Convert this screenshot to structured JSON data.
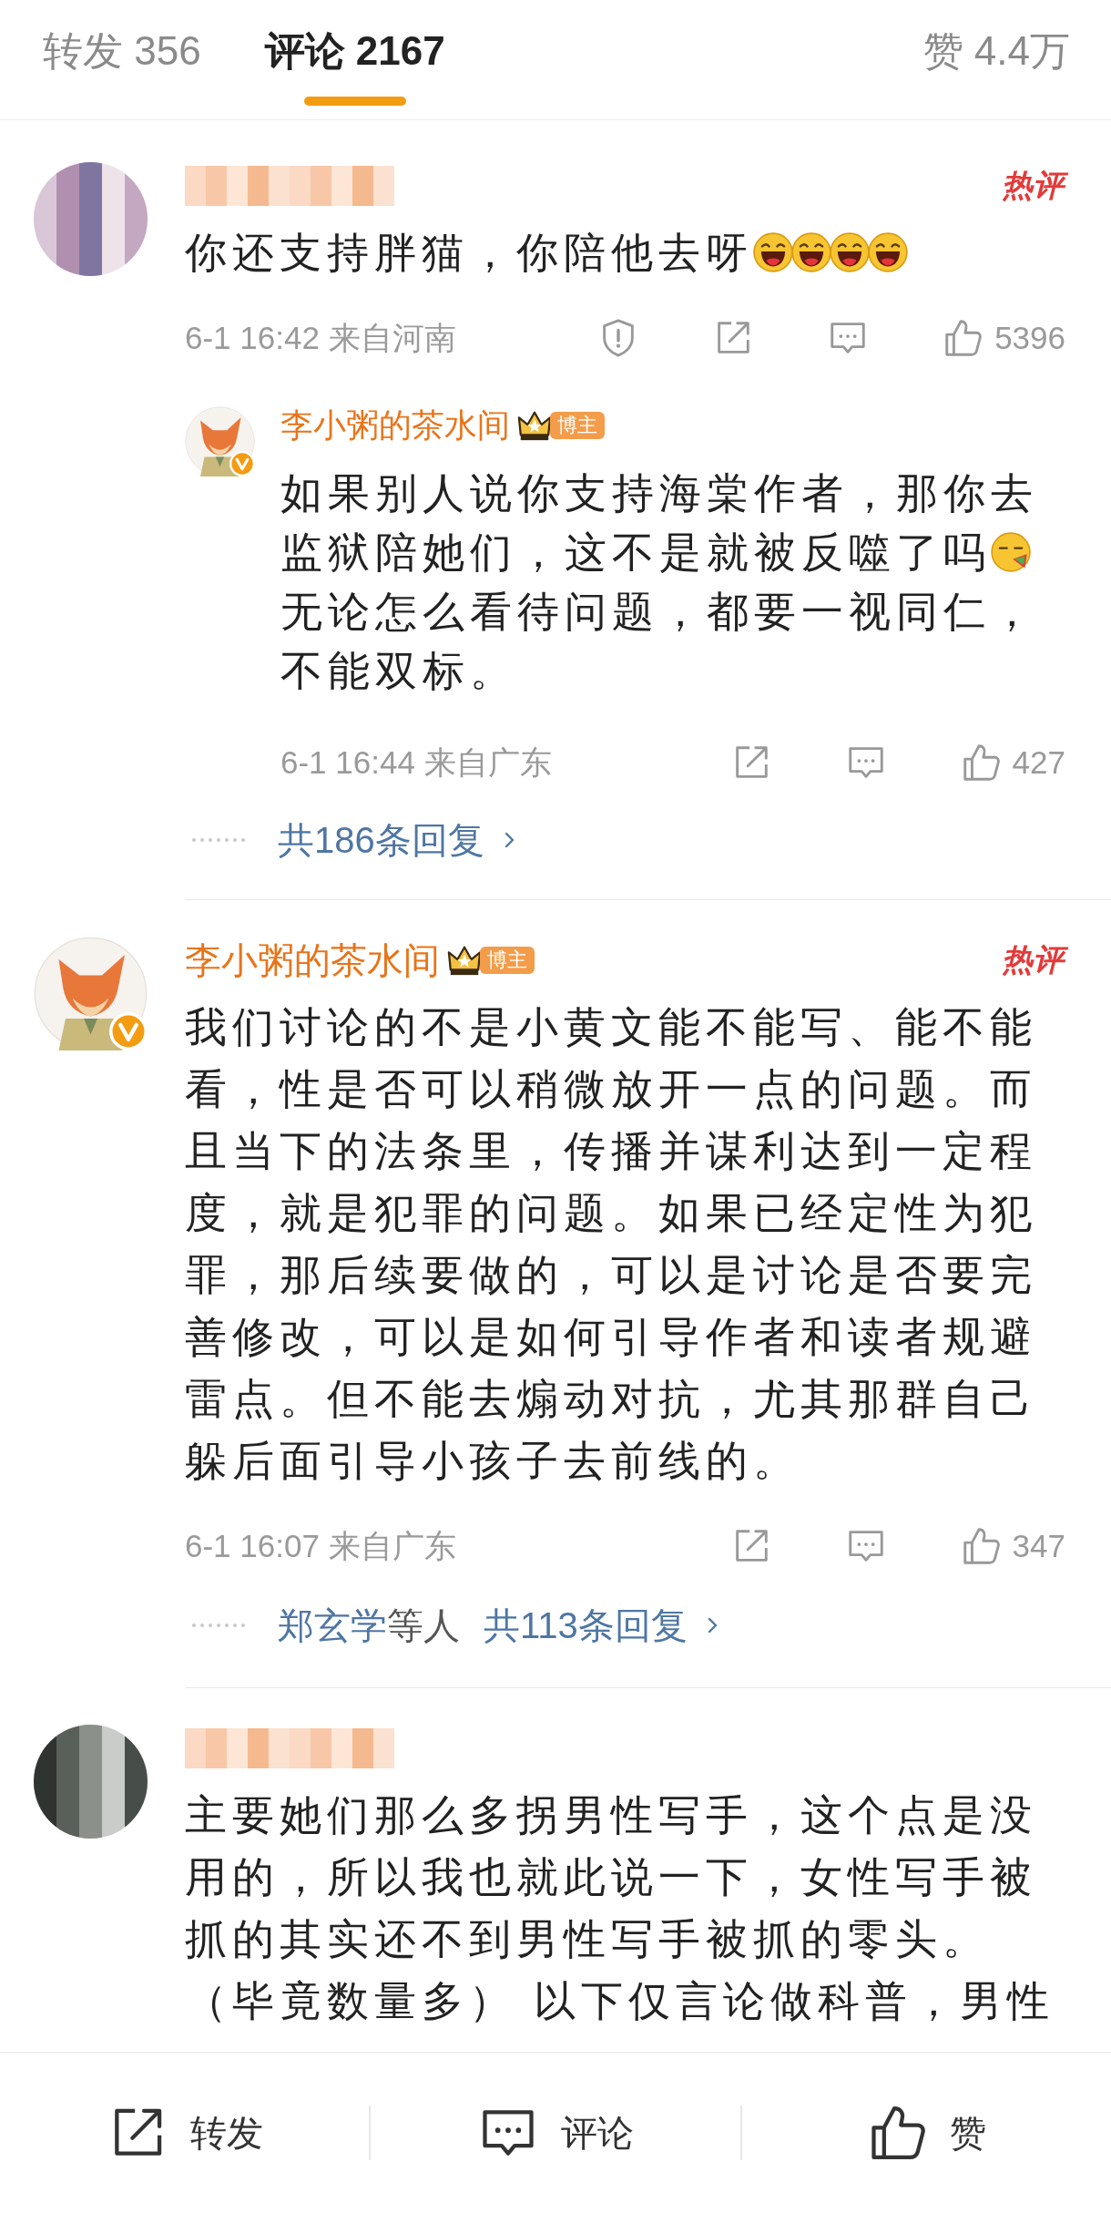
{
  "tabs": [
    {
      "label": "转发 356",
      "selected": false
    },
    {
      "label": "评论 2167",
      "selected": true
    },
    {
      "label": "赞 4.4万",
      "selected": false
    }
  ],
  "comments": [
    {
      "avatar": {
        "kind": "mosaic-light"
      },
      "author": {
        "blurred": true
      },
      "hot_label": "热评",
      "lines": [
        [
          {
            "kind": "text",
            "text": "你还支持胖猫，你陪他去呀"
          },
          {
            "kind": "laughing-emoji"
          },
          {
            "kind": "laughing-emoji"
          },
          {
            "kind": "laughing-emoji"
          },
          {
            "kind": "laughing-emoji"
          }
        ]
      ],
      "time": "6-1 16:42 来自河南",
      "actions": [
        {
          "kind": "report"
        },
        {
          "kind": "share"
        },
        {
          "kind": "comment"
        },
        {
          "kind": "like",
          "count": "5396"
        }
      ],
      "reply": {
        "avatar": {
          "kind": "cartoon"
        },
        "author": {
          "blurred": false,
          "name": "李小粥的茶水间",
          "verified": true,
          "role_badge": "博主"
        },
        "lines": [
          [
            {
              "kind": "text",
              "text": "如果别人说你支持海棠作者，那你去"
            }
          ],
          [
            {
              "kind": "text",
              "text": "监狱陪她们，这不是就被反噬了吗"
            },
            {
              "kind": "smug-emoji"
            }
          ],
          [
            {
              "kind": "text",
              "text": "无论怎么看待问题，都要一视同仁，"
            }
          ],
          [
            {
              "kind": "text",
              "text": "不能双标。"
            }
          ]
        ],
        "time": "6-1 16:44 来自广东",
        "actions": [
          {
            "kind": "share"
          },
          {
            "kind": "comment"
          },
          {
            "kind": "like",
            "count": "427"
          }
        ]
      },
      "replies_link": {
        "count_text": "共186条回复"
      }
    },
    {
      "avatar": {
        "kind": "cartoon"
      },
      "author": {
        "blurred": false,
        "name": "李小粥的茶水间",
        "verified": true,
        "role_badge": "博主"
      },
      "hot_label": "热评",
      "lines": [
        [
          {
            "kind": "text",
            "text": "我们讨论的不是小黄文能不能写、能不能"
          }
        ],
        [
          {
            "kind": "text",
            "text": "看，性是否可以稍微放开一点的问题。而"
          }
        ],
        [
          {
            "kind": "text",
            "text": "且当下的法条里，传播并谋利达到一定程"
          }
        ],
        [
          {
            "kind": "text",
            "text": "度，就是犯罪的问题。如果已经定性为犯"
          }
        ],
        [
          {
            "kind": "text",
            "text": "罪，那后续要做的，可以是讨论是否要完"
          }
        ],
        [
          {
            "kind": "text",
            "text": "善修改，可以是如何引导作者和读者规避"
          }
        ],
        [
          {
            "kind": "text",
            "text": "雷点。但不能去煽动对抗，尤其那群自己"
          }
        ],
        [
          {
            "kind": "text",
            "text": "躲后面引导小孩子去前线的。"
          }
        ]
      ],
      "time": "6-1 16:07 来自广东",
      "actions": [
        {
          "kind": "share"
        },
        {
          "kind": "comment"
        },
        {
          "kind": "like",
          "count": "347"
        }
      ],
      "replies_link": {
        "users": "郑玄学",
        "suffix": "等人",
        "count_text": "共113条回复"
      }
    },
    {
      "avatar": {
        "kind": "mosaic-dark"
      },
      "author": {
        "blurred": true
      },
      "lines": [
        [
          {
            "kind": "text",
            "text": "主要她们那么多拐男性写手，这个点是没"
          }
        ],
        [
          {
            "kind": "text",
            "text": "用的，所以我也就此说一下，女性写手被"
          }
        ],
        [
          {
            "kind": "text",
            "text": "抓的其实还不到男性写手被抓的零头。"
          }
        ],
        [
          {
            "kind": "text",
            "text": "（毕竟数量多） 以下仅言论做科普，男性"
          }
        ]
      ]
    }
  ],
  "bottom_bar": [
    {
      "kind": "share",
      "label": "转发"
    },
    {
      "kind": "comment",
      "label": "评论"
    },
    {
      "kind": "like",
      "label": "赞"
    }
  ]
}
